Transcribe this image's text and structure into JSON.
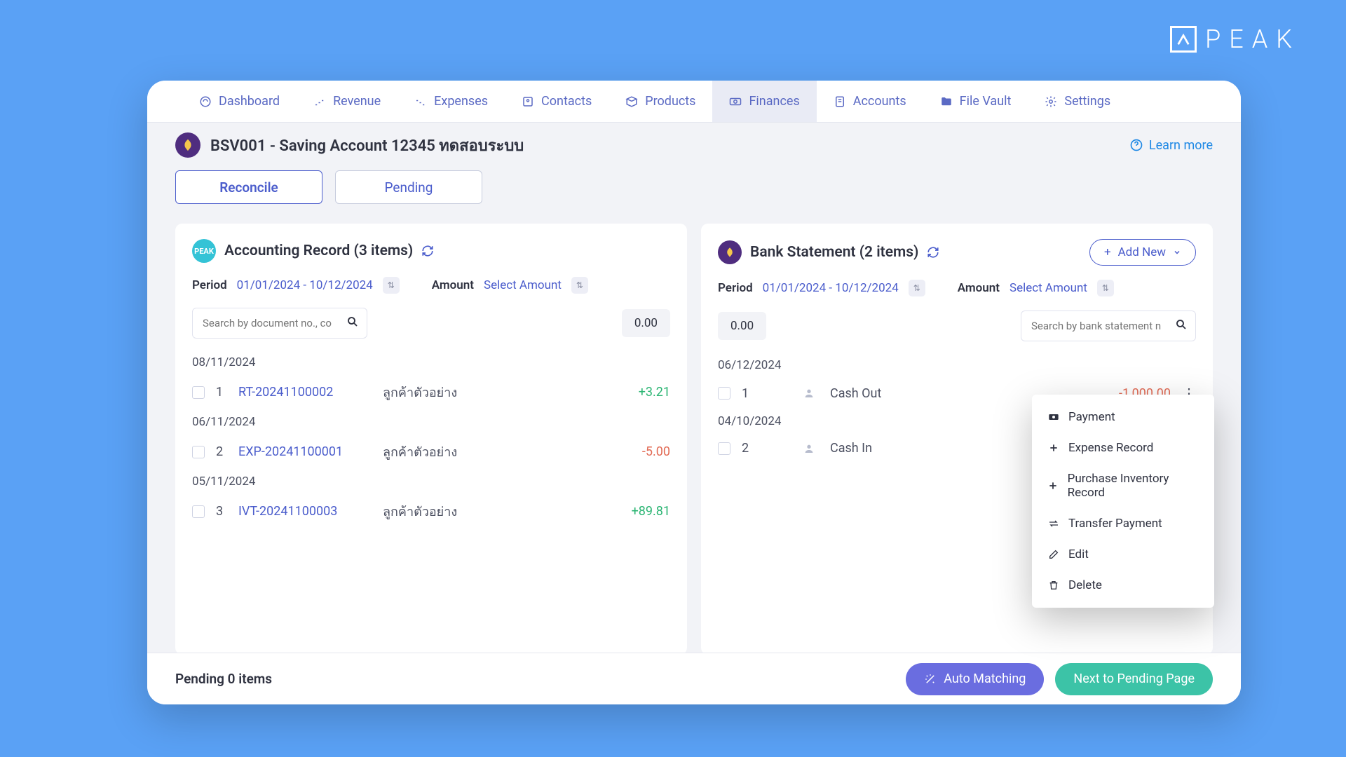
{
  "brand": "PEAK",
  "nav": [
    "Dashboard",
    "Revenue",
    "Expenses",
    "Contacts",
    "Products",
    "Finances",
    "Accounts",
    "File Vault",
    "Settings"
  ],
  "header": {
    "title": "BSV001 - Saving Account 12345 ทดสอบระบบ",
    "learn_more": "Learn more"
  },
  "tabs": [
    "Reconcile",
    "Pending"
  ],
  "left": {
    "title": "Accounting Record (3 items)",
    "period_label": "Period",
    "period_value": "01/01/2024 - 10/12/2024",
    "amount_label": "Amount",
    "amount_value": "Select Amount",
    "search_placeholder": "Search by document no., co",
    "total": "0.00",
    "groups": [
      {
        "date": "08/11/2024",
        "rows": [
          {
            "idx": "1",
            "doc": "RT-20241100002",
            "contact": "ลูกค้าตัวอย่าง",
            "amount": "+3.21"
          }
        ]
      },
      {
        "date": "06/11/2024",
        "rows": [
          {
            "idx": "2",
            "doc": "EXP-20241100001",
            "contact": "ลูกค้าตัวอย่าง",
            "amount": "-5.00"
          }
        ]
      },
      {
        "date": "05/11/2024",
        "rows": [
          {
            "idx": "3",
            "doc": "IVT-20241100003",
            "contact": "ลูกค้าตัวอย่าง",
            "amount": "+89.81"
          }
        ]
      }
    ]
  },
  "right": {
    "title": "Bank Statement (2 items)",
    "add_new": "Add New",
    "period_label": "Period",
    "period_value": "01/01/2024 - 10/12/2024",
    "amount_label": "Amount",
    "amount_value": "Select Amount",
    "search_placeholder": "Search by bank statement n",
    "total": "0.00",
    "groups": [
      {
        "date": "06/12/2024",
        "rows": [
          {
            "idx": "1",
            "type": "Cash Out",
            "amount": "-1,000.00"
          }
        ]
      },
      {
        "date": "04/10/2024",
        "rows": [
          {
            "idx": "2",
            "type": "Cash In",
            "amount": ""
          }
        ]
      }
    ]
  },
  "menu": [
    "Payment",
    "Expense Record",
    "Purchase Inventory Record",
    "Transfer Payment",
    "Edit",
    "Delete"
  ],
  "footer": {
    "pending": "Pending 0 items",
    "auto_matching": "Auto Matching",
    "next_pending": "Next to Pending Page"
  }
}
